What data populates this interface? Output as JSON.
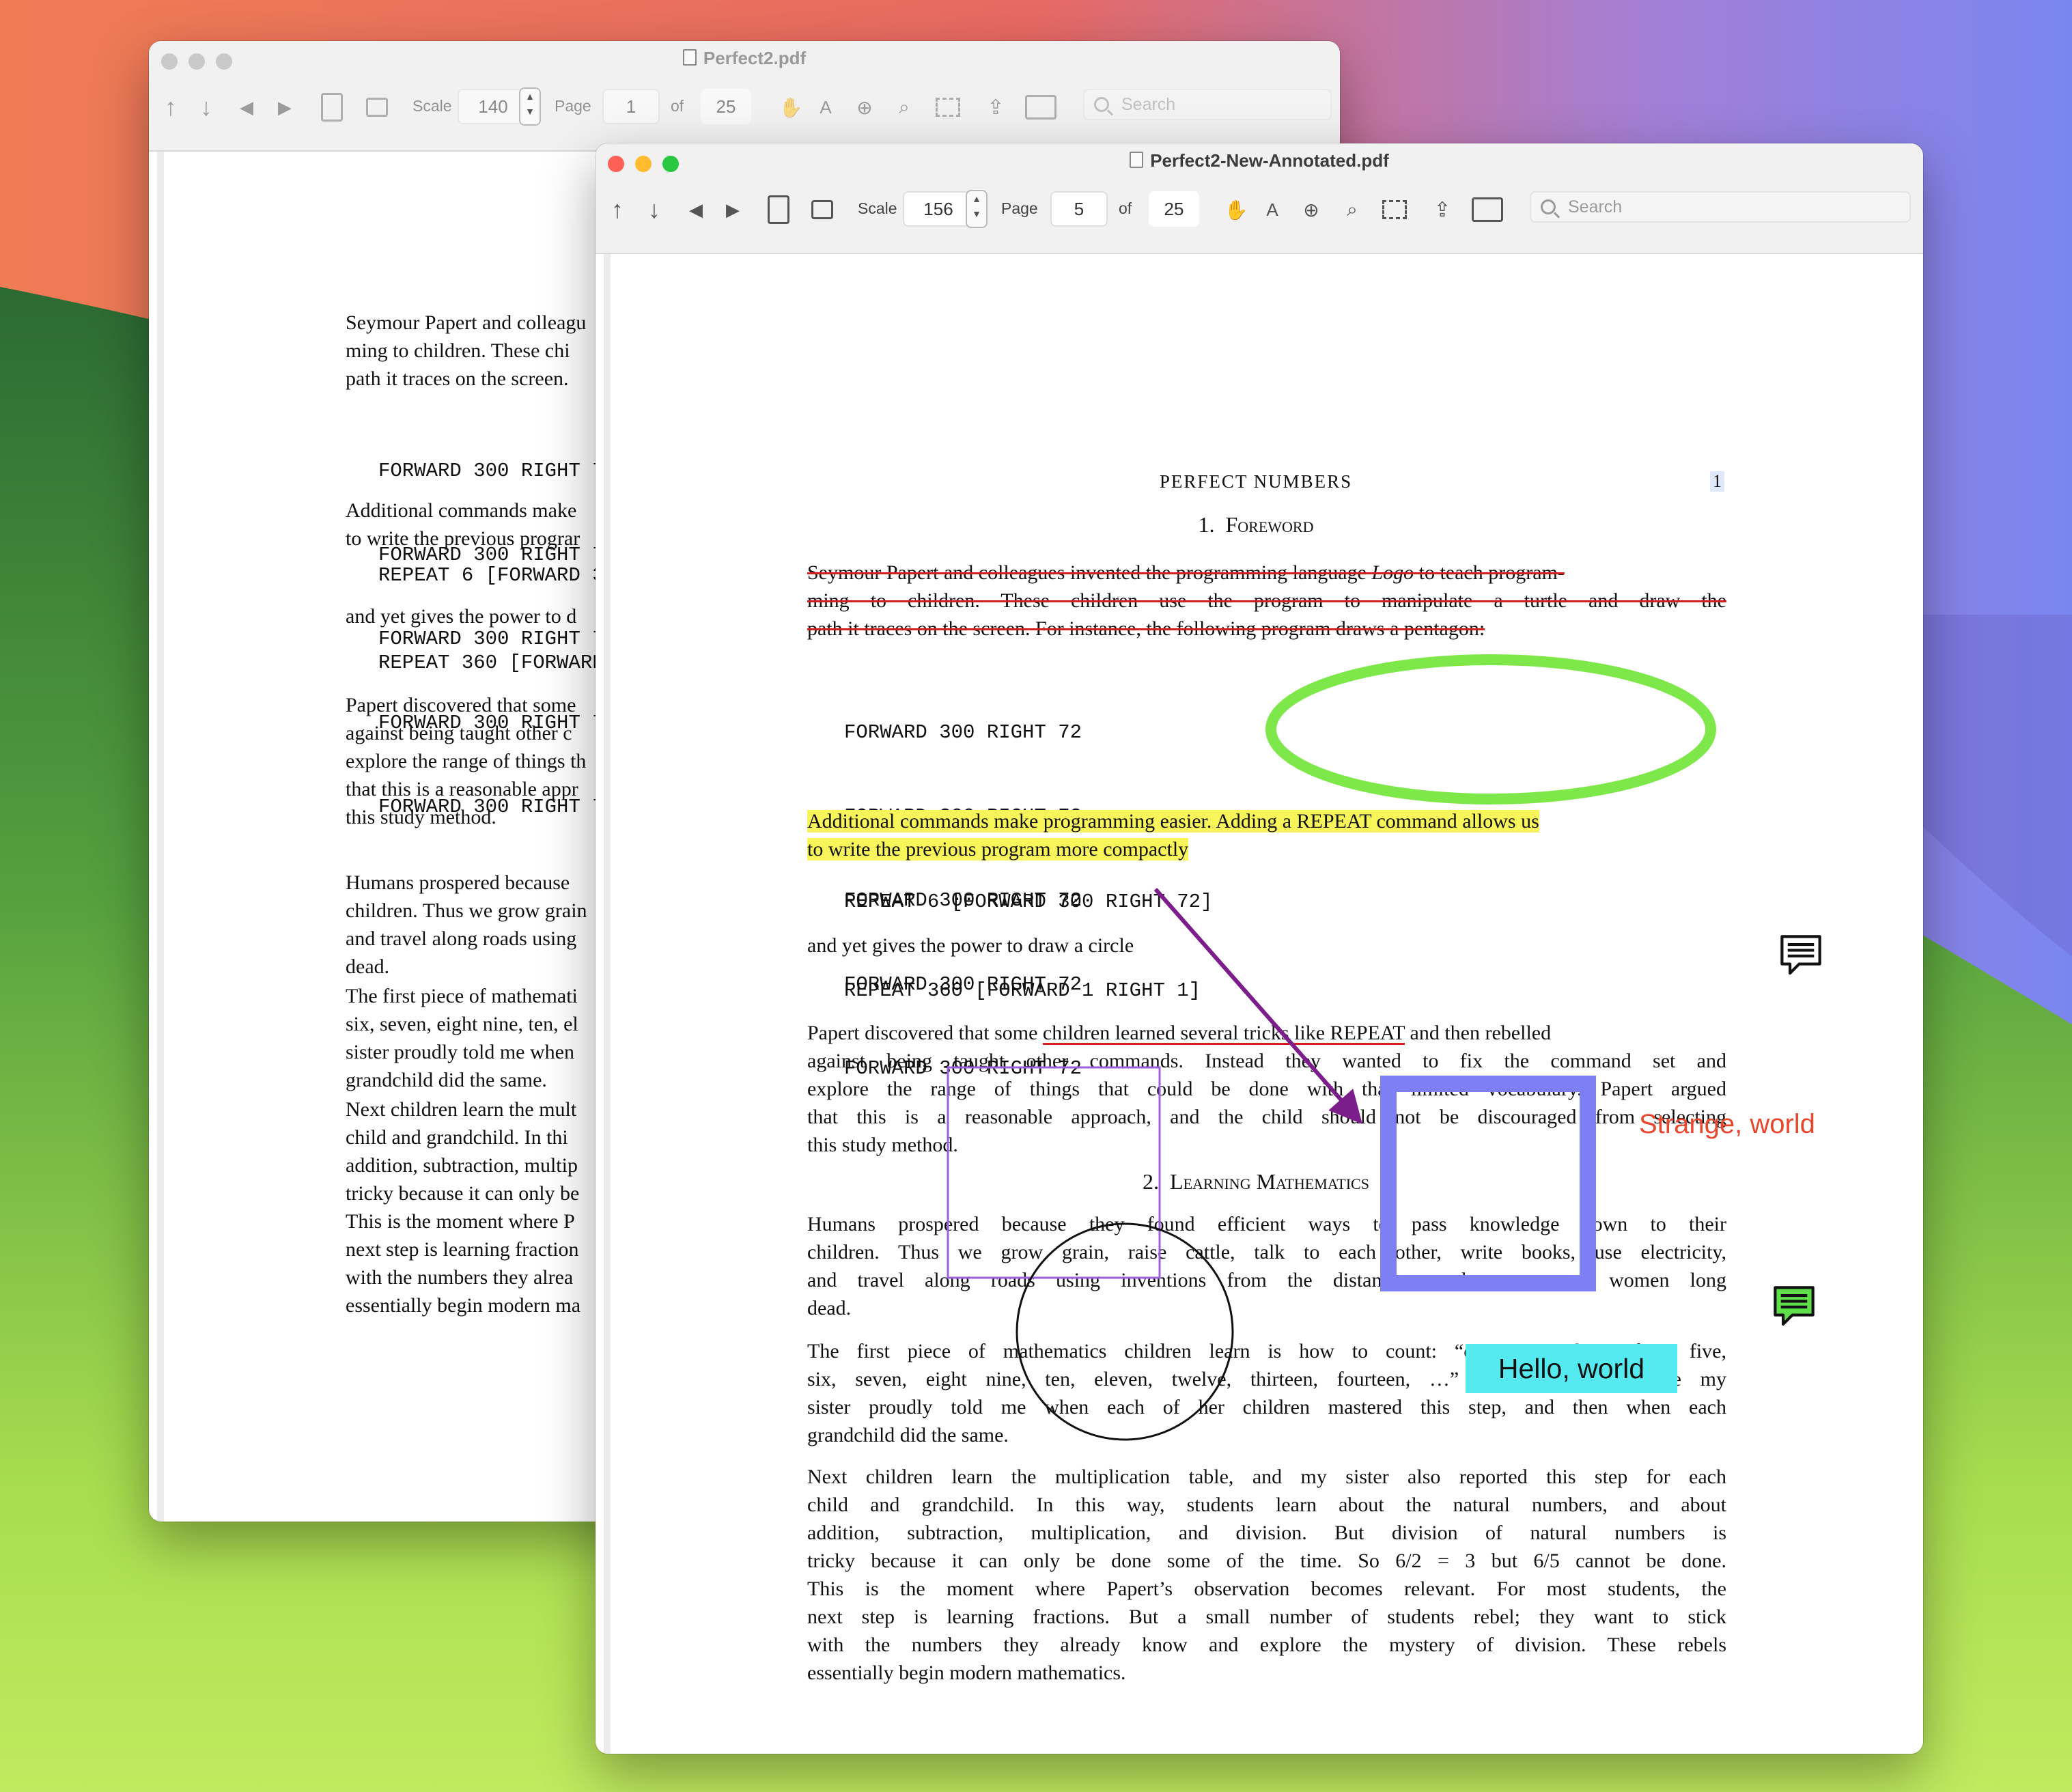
{
  "back_window": {
    "title": "Perfect2.pdf",
    "toolbar": {
      "scale_label": "Scale",
      "scale_value": "140",
      "page_label": "Page",
      "page_value": "1",
      "of_label": "of",
      "page_total": "25",
      "search_placeholder": "Search"
    },
    "lines": {
      "p1": [
        "Seymour Papert and colleagu",
        "ming to children.  These chi",
        "path it traces on the screen."
      ],
      "code1": [
        "FORWARD 300 RIGHT 72",
        "FORWARD 300 RIGHT 72",
        "FORWARD 300 RIGHT 72",
        "FORWARD 300 RIGHT 72",
        "FORWARD 300 RIGHT 72"
      ],
      "p2": [
        "Additional commands make",
        "to write the previous prograr"
      ],
      "code2": "REPEAT 6 [FORWARD 300",
      "p3": "and yet gives the power to d",
      "code3": "REPEAT 360 [FORWARD 1",
      "p4": [
        "Papert discovered that some",
        "against being taught other c",
        "explore the range of things th",
        "that this is a reasonable appr",
        "this study method."
      ],
      "p5": [
        "Humans prospered because",
        "children.  Thus we grow grain",
        "and travel along roads using",
        "dead."
      ],
      "p6": [
        "The first piece of mathemati",
        "six, seven, eight nine, ten, el",
        "sister proudly told me when",
        "grandchild did the same."
      ],
      "p7": [
        "Next children learn the mult",
        "child and grandchild.  In thi",
        "addition, subtraction, multip",
        "tricky because it can only be",
        "This is the moment where P",
        "next step is learning fraction",
        "with the numbers they alrea",
        "essentially begin modern ma"
      ]
    }
  },
  "front_window": {
    "title": "Perfect2-New-Annotated.pdf",
    "toolbar": {
      "scale_label": "Scale",
      "scale_value": "156",
      "page_label": "Page",
      "page_value": "5",
      "of_label": "of",
      "page_total": "25",
      "search_placeholder": "Search"
    },
    "page": {
      "running_head": "PERFECT NUMBERS",
      "page_number": "1",
      "section1_number": "1.",
      "section1_title": "Foreword",
      "p1_lines": [
        "Seymour Papert and colleagues invented the programming language ",
        "ming to children.  These children use the program to manipulate a turtle and draw the",
        "path it traces on the screen.  For instance, the following program draws a pentagon:"
      ],
      "p1_logo": "Logo",
      "p1_line1_tail": " to teach program-",
      "code1": [
        "FORWARD 300 RIGHT 72",
        "FORWARD 300 RIGHT 72",
        "FORWARD 300 RIGHT 72",
        "FORWARD 300 RIGHT 72",
        "FORWARD 300 RIGHT 72"
      ],
      "p2_line1": "Additional commands make programming easier.  Adding a REPEAT command allows us",
      "p2_line2": "to write the previous program more compactly",
      "code2": "REPEAT 6 [FORWARD 300 RIGHT 72]",
      "p3": "and yet gives the power to draw a circle",
      "code3": "REPEAT 360 [FORWARD 1 RIGHT 1]",
      "p4_line1_a": "Papert discovered that some ",
      "p4_line1_ul": "children learned several tricks like REPEAT",
      "p4_line1_b": " and then rebelled",
      "p4_lines": [
        "against being taught other commands.  Instead they wanted to fix the command set and",
        "explore the range of things that could be done with that limited vocabulary.  Papert argued",
        "that this is a reasonable approach, and the child should not be discouraged from selecting",
        "this study method."
      ],
      "section2_number": "2.",
      "section2_title": "Learning Mathematics",
      "p5_lines": [
        "Humans prospered because they found efficient ways to pass knowledge down to their",
        "children.  Thus we grow grain, raise cattle, talk to each other, write books, use electricity,",
        "and travel along roads using inventions from the distant past by men and women long",
        "dead."
      ],
      "p6_lines": [
        "The first piece of mathematics children learn is how to count: “one, two, three, four, five,",
        "six, seven, eight nine, ten, eleven, twelve, thirteen, fourteen, …”  I know this because my",
        "sister proudly told me when each of her children mastered this step, and then when each",
        "grandchild did the same."
      ],
      "p7_lines": [
        "Next children learn the multiplication table, and my sister also reported this step for each",
        "child and grandchild.  In this way, students learn about the natural numbers, and about",
        "addition, subtraction, multiplication, and division.  But division of natural numbers is",
        "tricky because it can only be done some of the time.  So 6/2 = 3 but 6/5 cannot be done.",
        "This is the moment where Papert’s observation becomes relevant.  For most students, the",
        "next step is learning fractions.  But a small number of students rebel; they want to stick",
        "with the numbers they already know and explore the mystery of division.  These rebels",
        "essentially begin modern mathematics."
      ]
    },
    "annotations": {
      "strange_text": "Strange, world",
      "hello_text": "Hello, world",
      "colors": {
        "ellipse": "#7ee84a",
        "arrow": "#7b1d8a",
        "square": "#7f7ff5",
        "thin_rect": "#9b5fe0",
        "highlight": "#f8f55a",
        "strike": "#d21f1f",
        "callout": "#55eaf0",
        "strange": "#e8472d"
      }
    }
  }
}
